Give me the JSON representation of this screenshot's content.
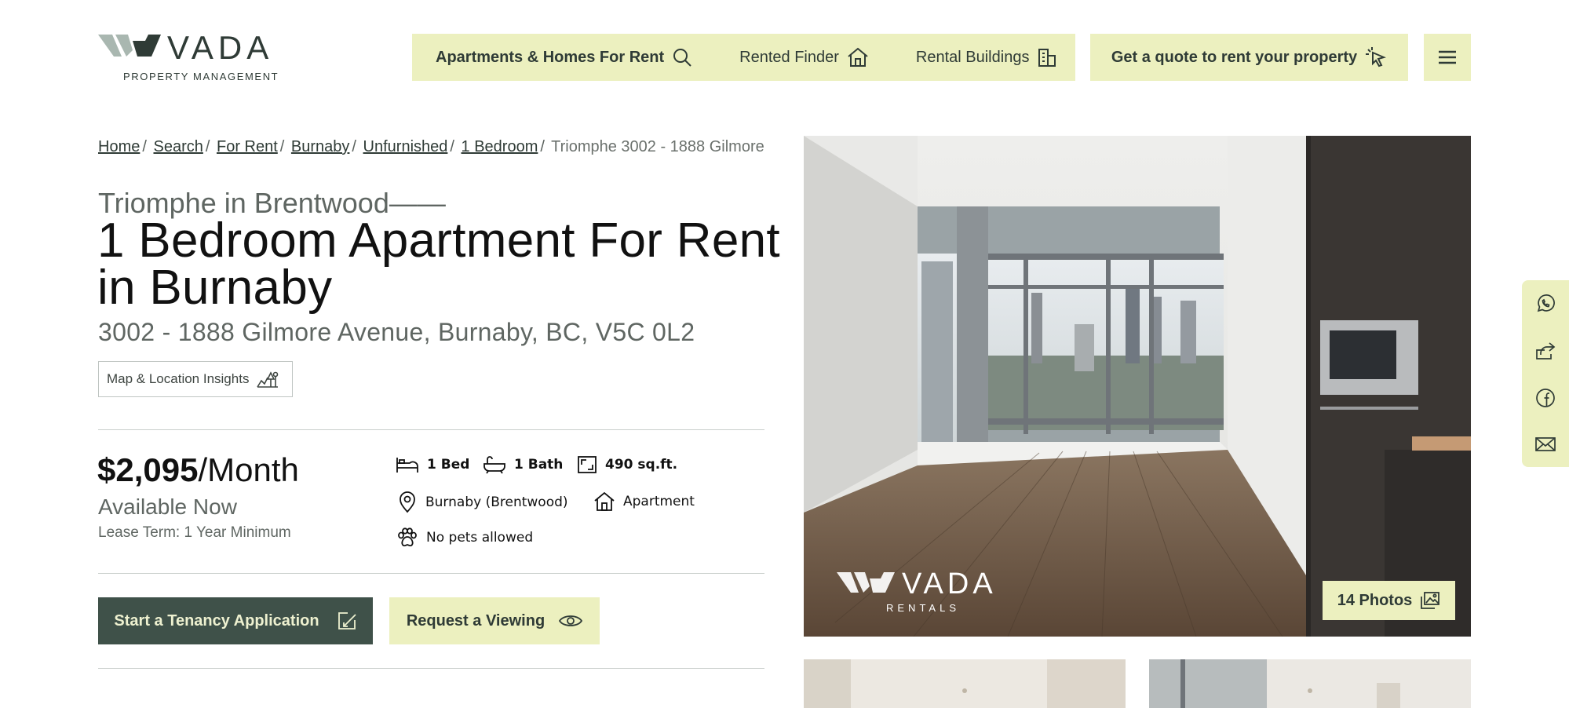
{
  "brand": {
    "name": "VADA",
    "tagline": "PROPERTY MANAGEMENT",
    "watermark_name": "VADA",
    "watermark_sub": "RENTALS"
  },
  "nav": {
    "items": [
      {
        "label": "Apartments & Homes For Rent",
        "icon": "search-icon"
      },
      {
        "label": "Rented Finder",
        "icon": "house-icon"
      },
      {
        "label": "Rental Buildings",
        "icon": "building-icon"
      }
    ],
    "quote_label": "Get a quote to rent your property",
    "quote_icon": "cursor-click-icon",
    "menu_icon": "hamburger-menu-icon"
  },
  "breadcrumb": {
    "items": [
      "Home",
      "Search",
      "For Rent",
      "Burnaby",
      "Unfurnished",
      "1 Bedroom"
    ],
    "separator": "/",
    "current": "Triomphe 3002 - 1888 Gilmore"
  },
  "listing": {
    "pre_title": "Triomphe in Brentwood——",
    "title": "1 Bedroom Apartment For Rent in Burnaby",
    "address": "3002 - 1888 Gilmore Avenue, Burnaby, BC, V5C 0L2",
    "map_button": "Map & Location Insights",
    "price": "$2,095",
    "price_unit": "/Month",
    "availability": "Available Now",
    "lease": "Lease Term: 1 Year Minimum",
    "features": {
      "beds": "1 Bed",
      "baths": "1 Bath",
      "area": "490 sq.ft.",
      "neighbourhood": "Burnaby (Brentwood)",
      "type": "Apartment",
      "pets": "No pets allowed"
    },
    "apply_button": "Start a Tenancy Application",
    "viewing_button": "Request a Viewing",
    "photos_button": "14 Photos"
  },
  "social": [
    "whatsapp-icon",
    "share-icon",
    "facebook-icon",
    "email-icon"
  ],
  "colors": {
    "accent": "#ecf0bf",
    "primary": "#3f5149",
    "text": "#2f3b36"
  }
}
